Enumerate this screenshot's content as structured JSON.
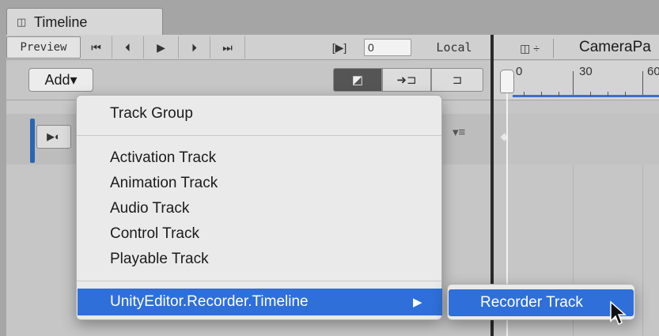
{
  "window": {
    "tab_icon": "◫",
    "tab_title": "Timeline"
  },
  "toolbar": {
    "preview_label": "Preview",
    "first_frame_icon": "⏮",
    "prev_frame_icon": "⏴",
    "play_icon": "▶",
    "next_frame_icon": "⏵",
    "last_frame_icon": "⏭",
    "loop_icon": "[▶]",
    "frame_value": "0",
    "space_label": "Local"
  },
  "tracks_header": {
    "add_label": "Add▾"
  },
  "timeline_header": {
    "duration_mode_icon": "◫ ÷",
    "camera_label": "CameraPa",
    "ruler_labels": [
      "0",
      "30",
      "60"
    ]
  },
  "add_menu": {
    "items": [
      {
        "label": "Track Group"
      },
      {
        "label": "Activation Track"
      },
      {
        "label": "Animation Track"
      },
      {
        "label": "Audio Track"
      },
      {
        "label": "Control Track"
      },
      {
        "label": "Playable Track"
      }
    ],
    "submenu_parent": "UnityEditor.Recorder.Timeline",
    "submenu_arrow": "▶"
  },
  "submenu": {
    "item": "Recorder Track"
  },
  "colors": {
    "highlight": "#2f6fda",
    "track_accent": "#2a66b3",
    "ruler_line": "#3b6fd1"
  }
}
